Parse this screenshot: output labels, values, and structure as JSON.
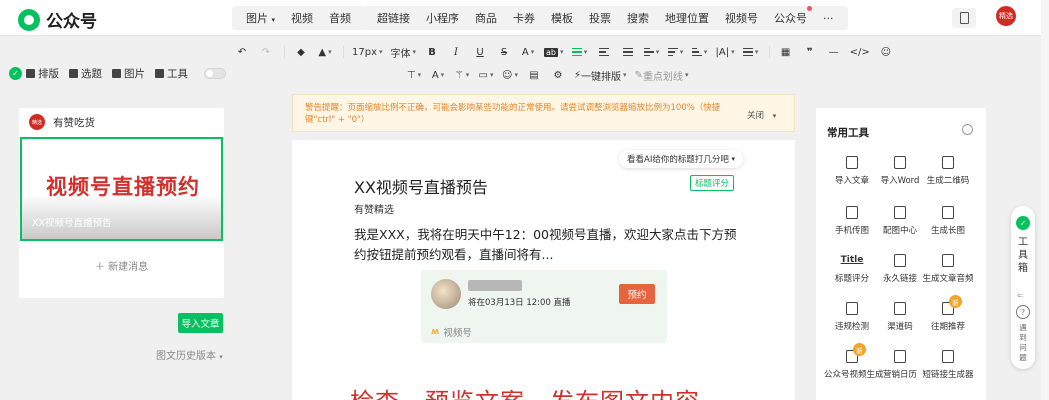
{
  "app": {
    "name": "公众号"
  },
  "nav": {
    "group1": [
      "图片",
      "视频",
      "音频"
    ],
    "group1_caret": "▾",
    "group2": [
      "超链接",
      "小程序",
      "商品",
      "卡券",
      "模板",
      "投票",
      "搜索",
      "地理位置",
      "视频号",
      "公众号"
    ],
    "more": "···",
    "avatar_text": "精选"
  },
  "toolbar": {
    "font_size": "17px",
    "font_family": "字体",
    "bold": "B",
    "italic": "I",
    "underline": "U",
    "strike": "S",
    "font_color": "A",
    "bg_color": "ab",
    "quote": "❞",
    "hr": "—",
    "code": "</>",
    "one_click_layout": "一键排版",
    "clear_format": "重点划线",
    "left_tools": [
      "排版",
      "选题",
      "图片",
      "工具"
    ]
  },
  "left_panel": {
    "account_name": "有赞吃货",
    "account_avatar": "精选",
    "cover_big_text": "视频号直播预约",
    "cover_sub_text": "XX视频号直播预告",
    "new_message": "新建消息",
    "import_button": "导入文章",
    "history": "图文历史版本"
  },
  "warning": {
    "message": "警告提醒：页面缩放比例不正确，可能会影响某些功能的正常使用。请尝试调整浏览器缩放比例为100%（快捷键\"ctrl\" + \"0\"）",
    "close": "关闭"
  },
  "editor": {
    "ai_tip": "看看AI给你的标题打几分吧",
    "title_score_button": "标题评分",
    "title": "XX视频号直播预告",
    "author": "有赞精选",
    "body": "我是XXX，我将在明天中午12：00视频号直播，欢迎大家点击下方预约按钮提前预约观看，直播间将有...",
    "card": {
      "time": "将在03月13日 12:00 直播",
      "reserve_button": "预约",
      "footer": "视频号"
    },
    "big_red_text": "检查、预览文案、发布图文内容"
  },
  "right_panel": {
    "title": "常用工具",
    "tools": [
      {
        "label": "导入文章",
        "icon": "import-icon"
      },
      {
        "label": "导入Word",
        "icon": "word-icon"
      },
      {
        "label": "生成二维码",
        "icon": "qrcode-icon"
      },
      {
        "label": "手机传图",
        "icon": "phone-upload-icon"
      },
      {
        "label": "配图中心",
        "icon": "image-center-icon"
      },
      {
        "label": "生成长图",
        "icon": "long-image-icon"
      },
      {
        "label": "标题评分",
        "icon": "title-score-icon",
        "glyph": "Title"
      },
      {
        "label": "永久链接",
        "icon": "link-icon"
      },
      {
        "label": "生成文章音频",
        "icon": "audio-icon"
      },
      {
        "label": "违规检测",
        "icon": "shield-icon"
      },
      {
        "label": "渠道码",
        "icon": "channel-code-icon"
      },
      {
        "label": "往期推荐",
        "icon": "thumb-icon",
        "badge": "新"
      },
      {
        "label": "公众号视频生成",
        "icon": "video-gen-icon",
        "badge": "新"
      },
      {
        "label": "营销日历",
        "icon": "calendar-icon"
      },
      {
        "label": "短链接生成器",
        "icon": "short-link-icon"
      }
    ]
  },
  "sidebox": {
    "label": "工具箱",
    "help": "遇到问题"
  },
  "colors": {
    "accent": "#07c160",
    "danger": "#d0312d",
    "warning_text": "#e3862d"
  }
}
